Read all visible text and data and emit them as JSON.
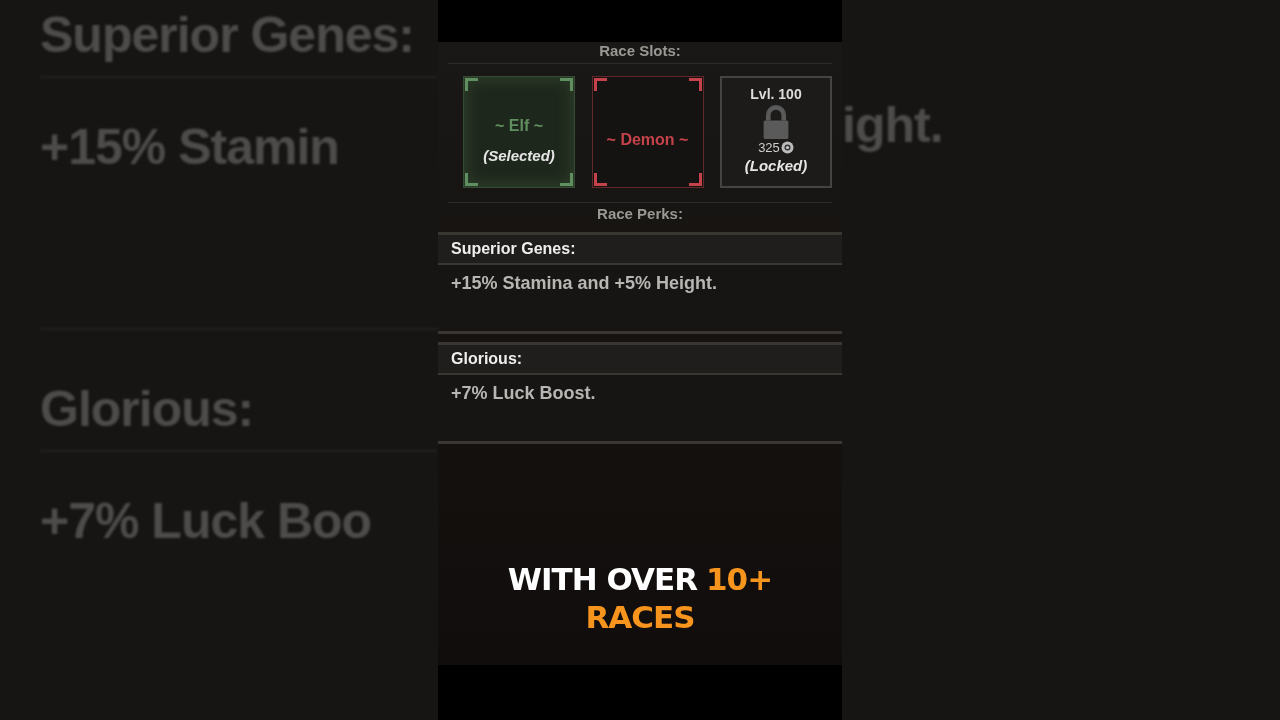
{
  "background": {
    "left_texts": [
      "Superior Genes:",
      "+15% Stamin",
      "Glorious:",
      "+7% Luck Boo"
    ],
    "right_texts": [
      "ight."
    ]
  },
  "race_slots": {
    "title": "Race Slots:",
    "slots": [
      {
        "kind": "race",
        "name": "~ Elf ~",
        "status": "(Selected)",
        "selected": true,
        "color": "#5f8f5f"
      },
      {
        "kind": "race",
        "name": "~ Demon ~",
        "selected": false,
        "color": "#c4424a"
      },
      {
        "kind": "locked",
        "level": "Lvl. 100",
        "cost": "325",
        "status": "(Locked)",
        "selected": false
      }
    ]
  },
  "race_perks": {
    "title": "Race Perks:",
    "perks": [
      {
        "name": "Superior Genes:",
        "description": "+15% Stamina and +5% Height."
      },
      {
        "name": "Glorious:",
        "description": "+7% Luck Boost."
      }
    ]
  },
  "caption": [
    {
      "text": "WITH OVER",
      "highlight": false
    },
    {
      "text": "10+",
      "highlight": true
    },
    {
      "text": "RACES",
      "highlight": true
    }
  ]
}
